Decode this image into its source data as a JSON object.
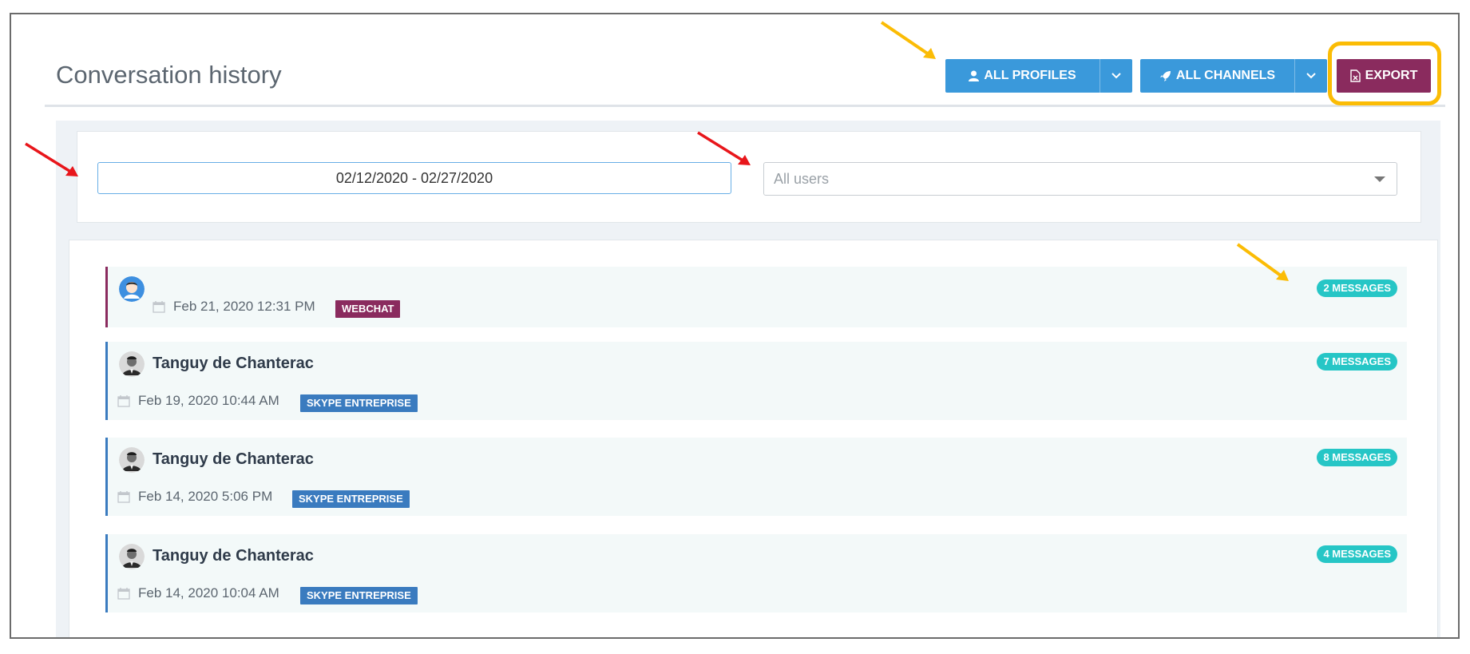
{
  "page": {
    "title": "Conversation history"
  },
  "toolbar": {
    "profiles_label": "ALL PROFILES",
    "channels_label": "ALL CHANNELS",
    "export_label": "EXPORT"
  },
  "filters": {
    "date_range": "02/12/2020 - 02/27/2020",
    "users_placeholder": "All users"
  },
  "conversations": [
    {
      "name": "",
      "date": "Feb 21, 2020 12:31 PM",
      "channel": "WEBCHAT",
      "messages": "2 MESSAGES"
    },
    {
      "name": "Tanguy de Chanterac",
      "date": "Feb 19, 2020 10:44 AM",
      "channel": "SKYPE ENTREPRISE",
      "messages": "7 MESSAGES"
    },
    {
      "name": "Tanguy de Chanterac",
      "date": "Feb 14, 2020 5:06 PM",
      "channel": "SKYPE ENTREPRISE",
      "messages": "8 MESSAGES"
    },
    {
      "name": "Tanguy de Chanterac",
      "date": "Feb 14, 2020 10:04 AM",
      "channel": "SKYPE ENTREPRISE",
      "messages": "4 MESSAGES"
    }
  ],
  "colors": {
    "primary_button": "#3a99db",
    "export_button": "#8a2b5e",
    "highlight": "#fbbc05",
    "annotation_red": "#e8161b",
    "message_badge": "#26c6c6"
  },
  "icons": {
    "profiles": "user-icon",
    "channels": "rocket-icon",
    "export": "excel-file-icon",
    "date": "calendar-icon"
  }
}
